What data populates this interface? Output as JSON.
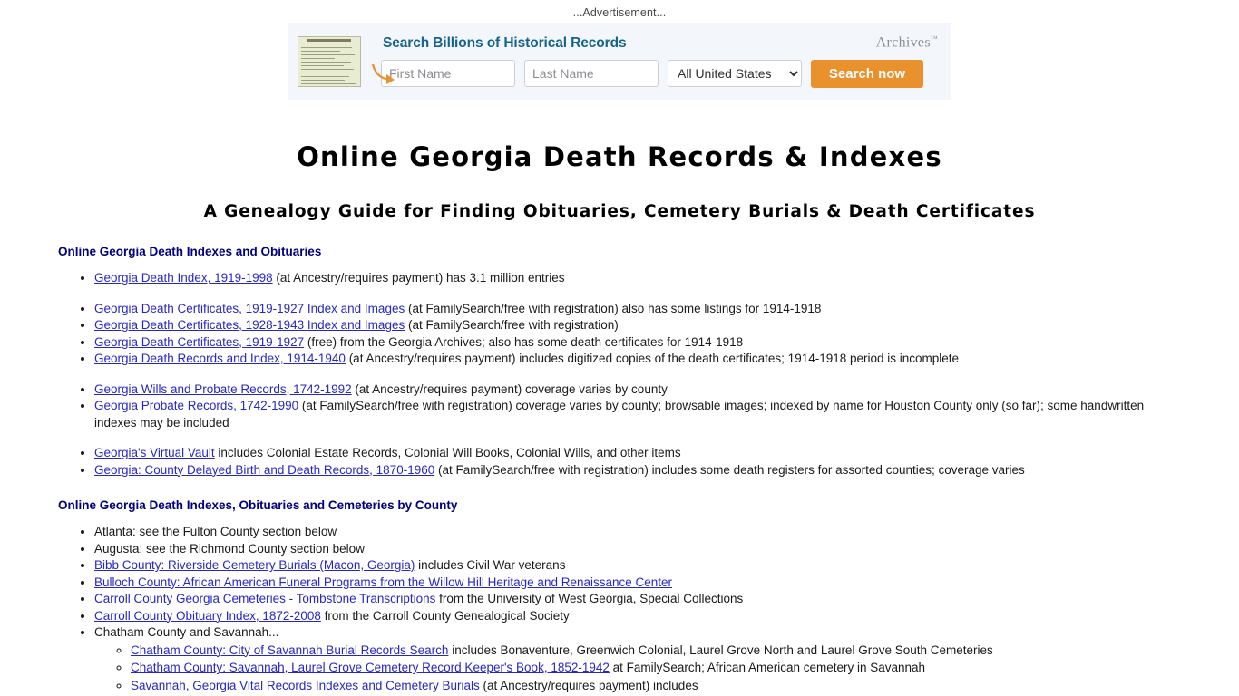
{
  "ad": {
    "label": "...Advertisement...",
    "headline": "Search Billions of Historical Records",
    "brand": "Archives",
    "brand_tm": "™",
    "first_name_placeholder": "First Name",
    "last_name_placeholder": "Last Name",
    "first_name_value": "",
    "last_name_value": "",
    "location_selected": "All United States",
    "location_options": [
      "All United States"
    ],
    "search_button": "Search now",
    "thumb_alt": "death-certificate-thumbnail"
  },
  "page": {
    "title": "Online Georgia Death Records & Indexes",
    "subtitle": "A Genealogy Guide for Finding Obituaries, Cemetery Burials & Death Certificates"
  },
  "section1": {
    "heading": "Online Georgia Death Indexes and Obituaries",
    "items": [
      {
        "link": "Georgia Death Index, 1919-1998",
        "text": " (at Ancestry/requires payment) has 3.1 million entries",
        "gap": false
      },
      {
        "link": "Georgia Death Certificates, 1919-1927 Index and Images",
        "text": " (at FamilySearch/free with registration) also has some listings for 1914-1918",
        "gap": true
      },
      {
        "link": "Georgia Death Certificates, 1928-1943 Index and Images",
        "text": " (at FamilySearch/free with registration)",
        "gap": false
      },
      {
        "link": "Georgia Death Certificates, 1919-1927",
        "text": " (free) from the Georgia Archives; also has some death certificates for 1914-1918",
        "gap": false
      },
      {
        "link": "Georgia Death Records and Index, 1914-1940",
        "text": " (at Ancestry/requires payment) includes digitized copies of the death certificates; 1914-1918 period is incomplete",
        "gap": false
      },
      {
        "link": "Georgia Wills and Probate Records, 1742-1992",
        "text": " (at Ancestry/requires payment) coverage varies by county",
        "gap": true
      },
      {
        "link": "Georgia Probate Records, 1742-1990",
        "text": " (at FamilySearch/free with registration) coverage varies by county; browsable images; indexed by name for Houston County only (so far); some handwritten indexes may be included",
        "gap": false
      },
      {
        "link": "Georgia's Virtual Vault",
        "text": " includes Colonial Estate Records, Colonial Will Books, Colonial Wills, and other items",
        "gap": true
      },
      {
        "link": "Georgia: County Delayed Birth and Death Records, 1870-1960",
        "text": " (at FamilySearch/free with registration) includes some death registers for assorted counties; coverage varies",
        "gap": false
      }
    ]
  },
  "section2": {
    "heading": "Online Georgia Death Indexes, Obituaries and Cemeteries by County",
    "items": [
      {
        "link": "",
        "text": "Atlanta: see the Fulton County section below"
      },
      {
        "link": "",
        "text": "Augusta: see the Richmond County section below"
      },
      {
        "link": "Bibb County: Riverside Cemetery Burials (Macon, Georgia)",
        "text": " includes Civil War veterans"
      },
      {
        "link": "Bulloch County: African American Funeral Programs from the Willow Hill Heritage and Renaissance Center",
        "text": ""
      },
      {
        "link": "Carroll County Georgia Cemeteries - Tombstone Transcriptions",
        "text": " from the University of West Georgia, Special Collections"
      },
      {
        "link": "Carroll County Obituary Index, 1872-2008",
        "text": " from the Carroll County Genealogical Society"
      },
      {
        "link": "",
        "text": "Chatham County and Savannah..."
      }
    ],
    "subitems": [
      {
        "link": "Chatham County: City of Savannah Burial Records Search",
        "text": " includes Bonaventure, Greenwich Colonial, Laurel Grove North and Laurel Grove South Cemeteries"
      },
      {
        "link": "Chatham County: Savannah, Laurel Grove Cemetery Record Keeper's Book, 1852-1942",
        "text": " at FamilySearch; African American cemetery in Savannah"
      },
      {
        "link": "Savannah, Georgia Vital Records Indexes and Cemetery Burials",
        "text": " (at Ancestry/requires payment) includes"
      }
    ]
  },
  "colors": {
    "heading": "#000080",
    "link": "#2727c8",
    "ad_accent": "#e8912d",
    "ad_headline": "#16638c",
    "ad_background": "#f3f7fb"
  }
}
